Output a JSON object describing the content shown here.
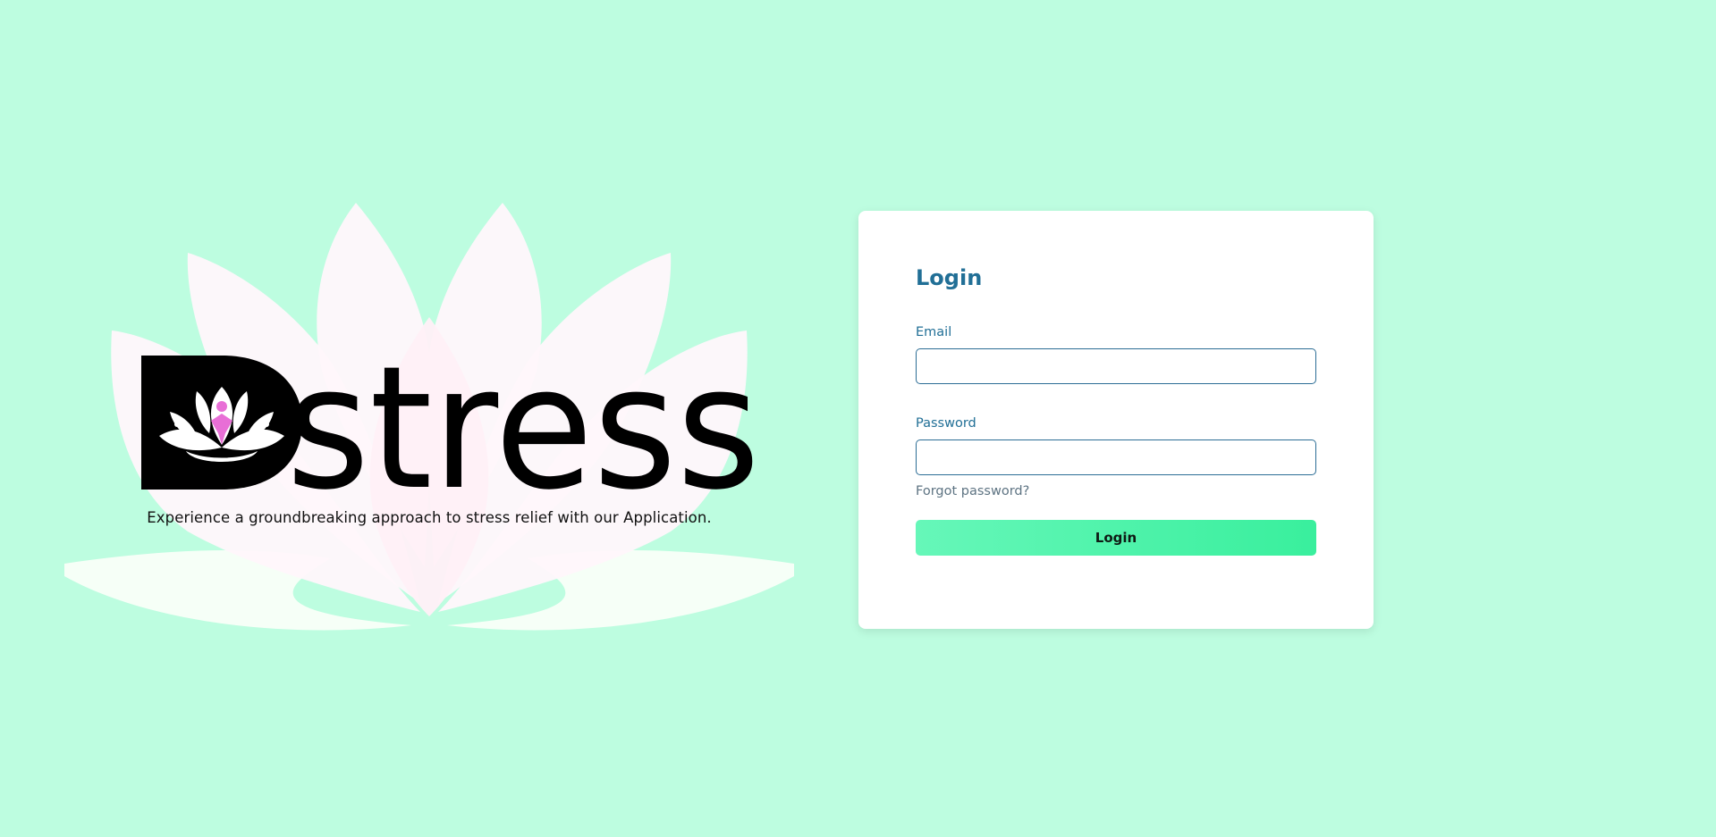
{
  "brand": {
    "name": "stress",
    "tagline": "Experience a groundbreaking approach to stress relief with our Application."
  },
  "login": {
    "title": "Login",
    "email_label": "Email",
    "email_value": "",
    "password_label": "Password",
    "password_value": "",
    "forgot_label": "Forgot password?",
    "submit_label": "Login"
  },
  "colors": {
    "background": "#bdfde0",
    "accent": "#216f96",
    "button_start": "#66f7b9",
    "button_end": "#39ef9d",
    "logo_figure": "#e86fd6"
  },
  "icons": {
    "background": "lotus-icon",
    "logo_mark": "lotus-meditation-icon"
  }
}
